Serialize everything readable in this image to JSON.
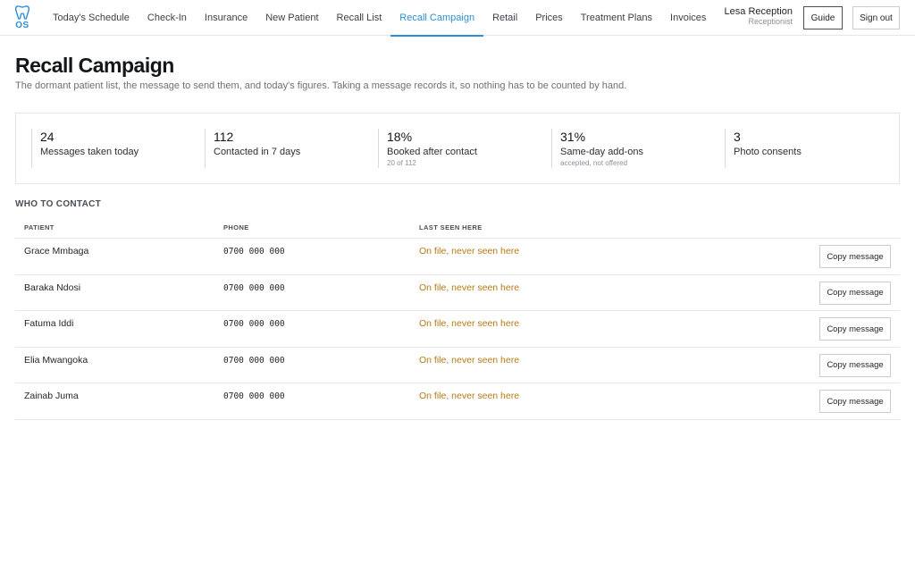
{
  "logo": {
    "text": "OS",
    "icon": "tooth-icon",
    "color": "#2a8fd6"
  },
  "nav": {
    "items": [
      {
        "label": "Today's Schedule"
      },
      {
        "label": "Check-In"
      },
      {
        "label": "Insurance"
      },
      {
        "label": "New Patient"
      },
      {
        "label": "Recall List"
      },
      {
        "label": "Recall Campaign"
      },
      {
        "label": "Retail"
      },
      {
        "label": "Prices"
      },
      {
        "label": "Treatment Plans"
      },
      {
        "label": "Invoices"
      }
    ],
    "active": "Recall Campaign"
  },
  "user": {
    "name": "Lesa Reception",
    "role": "Receptionist"
  },
  "buttons": {
    "guide": "Guide",
    "sign_out": "Sign out"
  },
  "header": {
    "title": "Recall Campaign",
    "subtitle": "The dormant patient list, the message to send them, and today's figures. Taking a message records it, so nothing has to be counted by hand."
  },
  "stats": [
    {
      "value": "24",
      "label": "Messages taken today",
      "note": ""
    },
    {
      "value": "112",
      "label": "Contacted in 7 days",
      "note": ""
    },
    {
      "value": "18%",
      "label": "Booked after contact",
      "note": "20 of 112"
    },
    {
      "value": "31%",
      "label": "Same-day add-ons",
      "note": "accepted, not offered"
    },
    {
      "value": "3",
      "label": "Photo consents",
      "note": ""
    }
  ],
  "section": {
    "title": "WHO TO CONTACT"
  },
  "table": {
    "headers": {
      "patient": "PATIENT",
      "phone": "PHONE",
      "last_seen": "LAST SEEN HERE"
    },
    "rows": [
      {
        "patient": "Grace Mmbaga",
        "phone": "0700 000 000",
        "last_seen": "On file, never seen here",
        "action": "Copy message"
      },
      {
        "patient": "Baraka Ndosi",
        "phone": "0700 000 000",
        "last_seen": "On file, never seen here",
        "action": "Copy message"
      },
      {
        "patient": "Fatuma Iddi",
        "phone": "0700 000 000",
        "last_seen": "On file, never seen here",
        "action": "Copy message"
      },
      {
        "patient": "Elia Mwangoka",
        "phone": "0700 000 000",
        "last_seen": "On file, never seen here",
        "action": "Copy message"
      },
      {
        "patient": "Zainab Juma",
        "phone": "0700 000 000",
        "last_seen": "On file, never seen here",
        "action": "Copy message"
      }
    ]
  },
  "colors": {
    "accent": "#2a8fd6",
    "warning_text": "#b37a14"
  }
}
